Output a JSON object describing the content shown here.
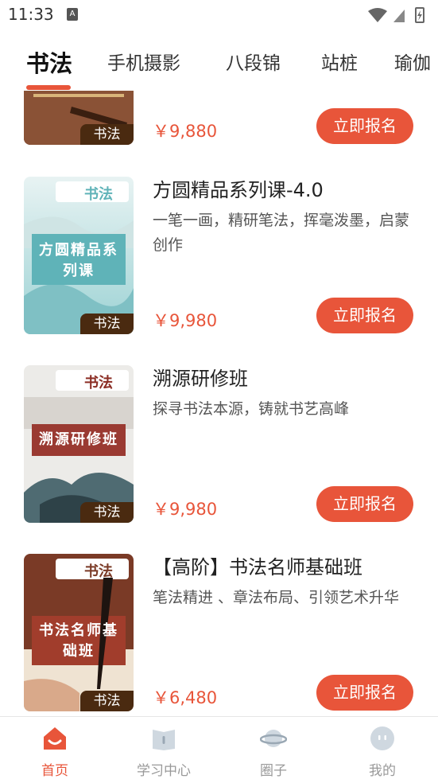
{
  "status_bar": {
    "time": "11:33",
    "notif_icon": "A"
  },
  "tabs": [
    {
      "label": "书法"
    },
    {
      "label": "手机摄影"
    },
    {
      "label": "八段锦"
    },
    {
      "label": "站桩"
    },
    {
      "label": "瑜伽"
    }
  ],
  "courses": [
    {
      "title": "",
      "desc": "",
      "price": "￥9,880",
      "tag": "书法",
      "button": "立即报名"
    },
    {
      "title": "方圆精品系列课-4.0",
      "desc": "一笔一画，精研笔法，挥毫泼墨，启蒙创作",
      "price": "￥9,980",
      "tag": "书法",
      "thumb_cat": "书法",
      "thumb_title": "方圆精品系列课",
      "button": "立即报名"
    },
    {
      "title": "溯源研修班",
      "desc": "探寻书法本源，铸就书艺高峰",
      "price": "￥9,980",
      "tag": "书法",
      "thumb_cat": "书法",
      "thumb_title": "溯源研修班",
      "button": "立即报名"
    },
    {
      "title": "【高阶】书法名师基础班",
      "desc": "笔法精进 、章法布局、引领艺术升华",
      "price": "￥6,480",
      "tag": "书法",
      "thumb_cat": "书法",
      "thumb_title": "书法名师基础班",
      "button": "立即报名"
    }
  ],
  "bottom_nav": [
    {
      "label": "首页",
      "icon": "home-icon"
    },
    {
      "label": "学习中心",
      "icon": "book-icon"
    },
    {
      "label": "圈子",
      "icon": "planet-icon"
    },
    {
      "label": "我的",
      "icon": "profile-icon"
    }
  ],
  "colors": {
    "accent": "#e8553a",
    "tag_bg": "#4a2a10"
  }
}
